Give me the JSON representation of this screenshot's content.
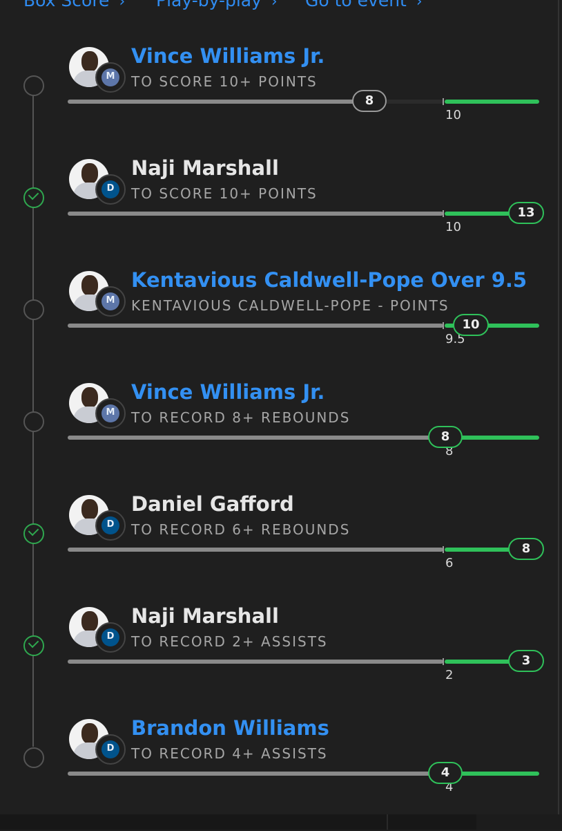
{
  "nav": {
    "box_score": "Box Score",
    "play_by_play": "Play-by-play",
    "go_to_event": "Go to event"
  },
  "legs": [
    {
      "name": "Vince Williams Jr.",
      "desc": "TO SCORE 10+ POINTS",
      "current": "8",
      "target": "10",
      "team": "MEM",
      "status": "pending",
      "progress": 0.8
    },
    {
      "name": "Naji Marshall",
      "desc": "TO SCORE 10+ POINTS",
      "current": "13",
      "target": "10",
      "team": "DAL",
      "status": "won",
      "progress": 1.0
    },
    {
      "name": "Kentavious Caldwell-Pope Over 9.5",
      "desc": "KENTAVIOUS CALDWELL-POPE - POINTS",
      "current": "10",
      "target": "9.5",
      "team": "MEM",
      "status": "pending",
      "progress": 1.0
    },
    {
      "name": "Vince Williams Jr.",
      "desc": "TO RECORD 8+ REBOUNDS",
      "current": "8",
      "target": "8",
      "team": "MEM",
      "status": "pending",
      "progress": 1.0
    },
    {
      "name": "Daniel Gafford",
      "desc": "TO RECORD 6+ REBOUNDS",
      "current": "8",
      "target": "6",
      "team": "DAL",
      "status": "won",
      "progress": 1.0
    },
    {
      "name": "Naji Marshall",
      "desc": "TO RECORD 2+ ASSISTS",
      "current": "3",
      "target": "2",
      "team": "DAL",
      "status": "won",
      "progress": 1.0
    },
    {
      "name": "Brandon Williams",
      "desc": "TO RECORD 4+ ASSISTS",
      "current": "4",
      "target": "4",
      "team": "DAL",
      "status": "pending",
      "progress": 1.0
    }
  ],
  "colors": {
    "link_blue": "#3390f2",
    "success_green": "#2fc15a",
    "background": "#1f1f1f"
  }
}
